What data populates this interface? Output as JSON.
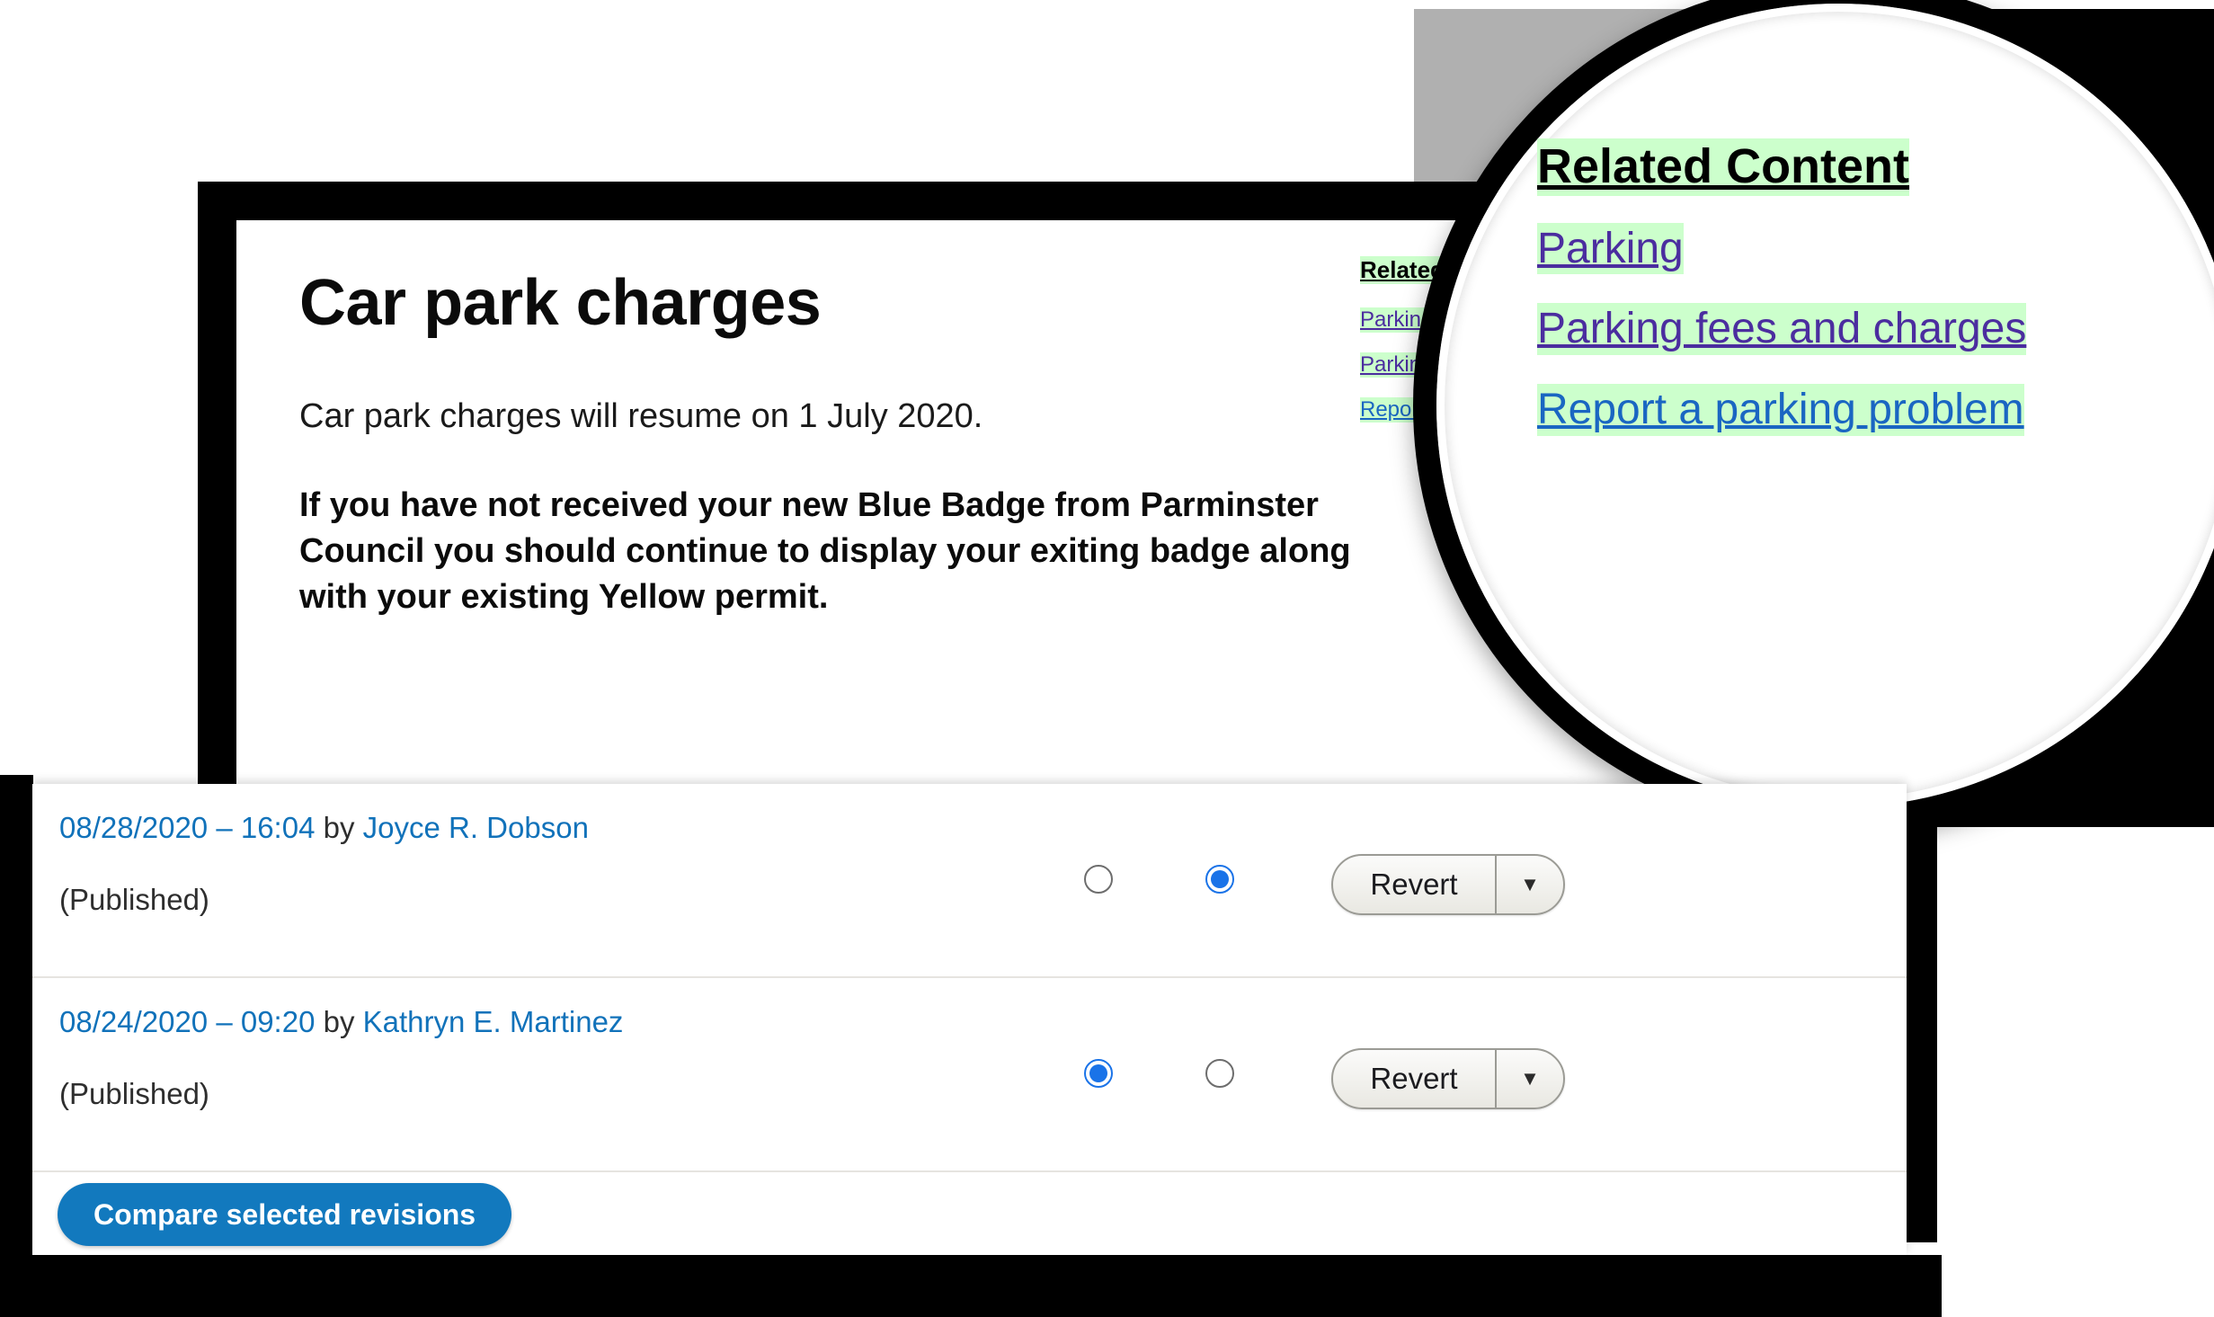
{
  "document": {
    "title": "Car park charges",
    "lead_paragraph": "Car park charges will resume on 1 July 2020.",
    "notice_paragraph": "If you have not received your new Blue Badge from Parminster Council you should continue to display your exiting badge along with your existing Yellow permit."
  },
  "related_content": {
    "heading": "Related Content",
    "links": [
      {
        "label": "Parking",
        "state": "visited"
      },
      {
        "label": "Parking fees and charges",
        "state": "visited"
      },
      {
        "label": "Report a parking problem",
        "state": "unvisited"
      }
    ]
  },
  "revisions": {
    "rows": [
      {
        "date": "08/28/2020 – 16:04",
        "by_label": "by",
        "author": "Joyce R. Dobson",
        "status": "(Published)",
        "radio_left_checked": false,
        "radio_right_checked": true,
        "revert_label": "Revert",
        "revert_arrow": "▼"
      },
      {
        "date": "08/24/2020 – 09:20",
        "by_label": "by",
        "author": "Kathryn E. Martinez",
        "status": "(Published)",
        "radio_left_checked": true,
        "radio_right_checked": false,
        "revert_label": "Revert",
        "revert_arrow": "▼"
      }
    ],
    "compare_button_label": "Compare selected revisions"
  },
  "colors": {
    "link_visited": "#4b2d9f",
    "link_unvisited": "#1a66c2",
    "highlight": "#ccffcc",
    "accent_blue": "#1279be",
    "radio_blue": "#1a73e8",
    "backdrop_gray": "#b0b0b0",
    "meta_blue": "#1172ba"
  }
}
